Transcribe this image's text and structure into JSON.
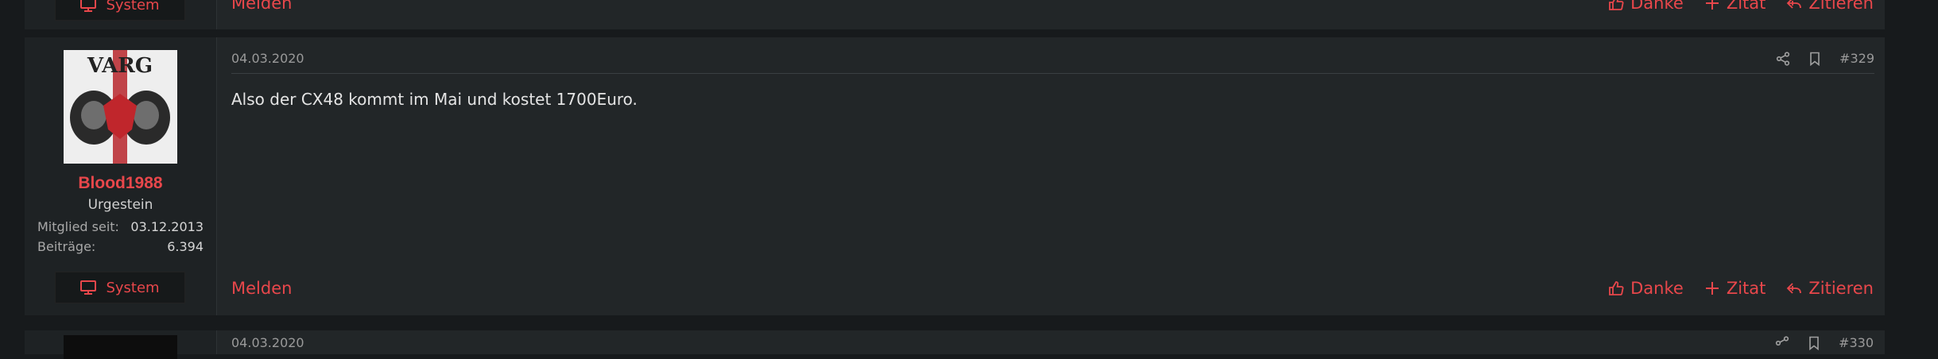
{
  "prev_post": {
    "system_label": "System",
    "report_label": "Melden",
    "thanks_label": "Danke",
    "quote_label": "Zitat",
    "reply_quote_label": "Zitieren"
  },
  "post": {
    "date": "04.03.2020",
    "number": "#329",
    "body": "Also der CX48 kommt im Mai und kostet 1700Euro.",
    "author": {
      "name": "Blood1988",
      "rank": "Urgestein",
      "member_since_label": "Mitglied seit:",
      "member_since": "03.12.2013",
      "posts_label": "Beiträge:",
      "posts": "6.394",
      "system_label": "System"
    },
    "report_label": "Melden",
    "thanks_label": "Danke",
    "quote_label": "Zitat",
    "reply_quote_label": "Zitieren",
    "icons": [
      "share-icon",
      "bookmark-icon"
    ]
  },
  "next_post": {
    "date": "04.03.2020",
    "number": "#330"
  },
  "colors": {
    "accent": "#e8474b",
    "background": "#171a1c",
    "post_bg": "#222628",
    "sidebar_bg": "#1e2224"
  }
}
